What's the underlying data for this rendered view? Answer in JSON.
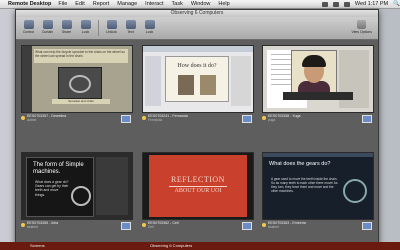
{
  "menubar": {
    "app_name": "Remote Desktop",
    "menus": [
      "File",
      "Edit",
      "Report",
      "Manage",
      "Interact",
      "Task",
      "Window",
      "Help"
    ],
    "clock": "Wed 1:17 PM"
  },
  "window": {
    "title": "Observing 6 Computers",
    "toolbar": {
      "buttons": [
        "Control",
        "Curtain",
        "Share",
        "Lock",
        "Unlock",
        "Text",
        "Lock"
      ],
      "right_label": "View Options"
    }
  },
  "screens": [
    {
      "computer": "EES0703357 - Dewelina",
      "user": "Admin",
      "slide_text": "What can help the bicycle sprocket to the chain on the wheel so the wheel can spread in the chain.",
      "caption_text": "Sprocket and chain"
    },
    {
      "computer": "EES0703241 - Fernanda",
      "user": "Fernanda",
      "slide_title": "How does it do?"
    },
    {
      "computer": "EES0703358 - Yuga",
      "user": "yuga"
    },
    {
      "computer": "EES0703355 - Ikha",
      "user": "student",
      "slide_title": "The form of Simple machines.",
      "slide_body": "What does a gear do? Gears can get by their teeth and move things."
    },
    {
      "computer": "EES0703362 - Cell",
      "user": "Cell",
      "slide_title": "REFLECTION",
      "slide_subtitle": "ABOUT OUR UOI"
    },
    {
      "computer": "EES0703363 - Emeeria",
      "user": "student",
      "slide_title": "What does the gears do?",
      "slide_body": "A gear used to move the teeth inside the chain. So as many teeth to each other there move! As they turn, they force them and move and the other machines."
    }
  ],
  "bottom": {
    "tab": "Screens",
    "mid": "Observing 6 Computers"
  },
  "colors": {
    "desktop_red": "#8e1f13",
    "window_gray": "#5e5e5e",
    "status_yellow": "#f2c94c"
  }
}
